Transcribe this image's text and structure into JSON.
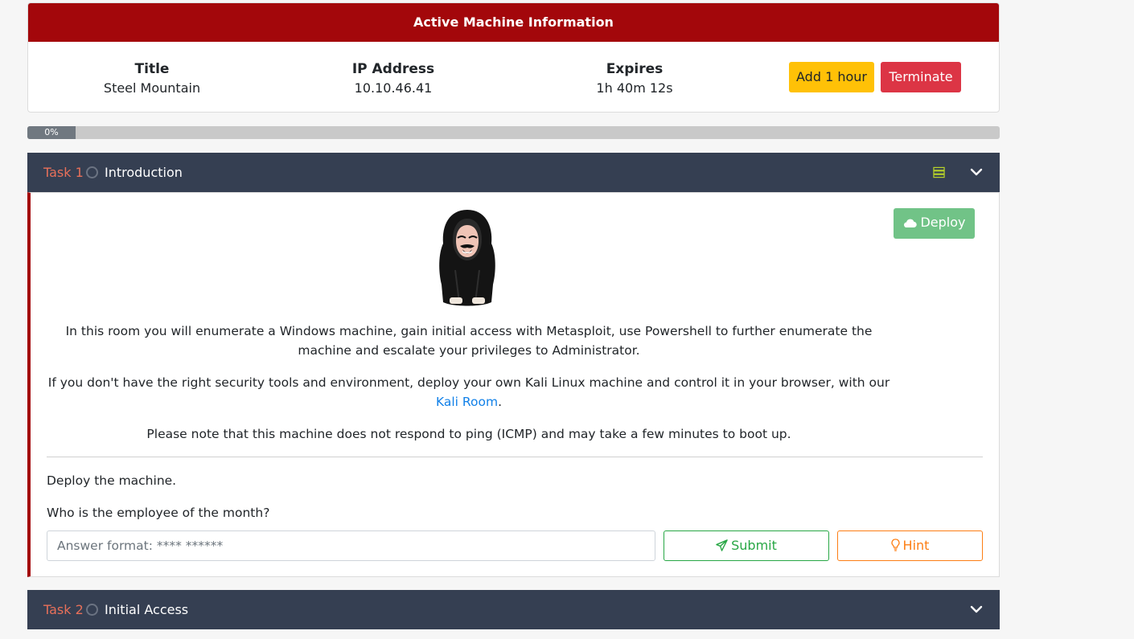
{
  "machine": {
    "header": "Active Machine Information",
    "title_label": "Title",
    "title_value": "Steel Mountain",
    "ip_label": "IP Address",
    "ip_value": "10.10.46.41",
    "expires_label": "Expires",
    "expires_value": "1h 40m 12s",
    "add_hour_label": "Add 1 hour",
    "terminate_label": "Terminate"
  },
  "progress": {
    "label": "0%",
    "value_percent": 0
  },
  "tasks": [
    {
      "number": "Task 1",
      "title": "Introduction",
      "deploy_label": "Deploy",
      "paragraphs": [
        "In this room you will enumerate a Windows machine, gain initial access with Metasploit, use Powershell to further enumerate the machine and escalate your privileges to Administrator.",
        "Please note that this machine does not respond to ping (ICMP) and may take a few minutes to boot up."
      ],
      "kali_para_prefix": "If you don't have the right security tools and environment, deploy your own Kali Linux machine and control it in your browser, with our ",
      "kali_link_text": "Kali Room",
      "kali_para_suffix": ".",
      "questions": [
        "Deploy the machine.",
        "Who is the employee of the month?"
      ],
      "answer_placeholder": "Answer format: **** ******",
      "submit_label": "Submit",
      "hint_label": "Hint"
    },
    {
      "number": "Task 2",
      "title": "Initial Access"
    }
  ],
  "colors": {
    "header_red": "#a3070b",
    "task_bar": "#353f52",
    "task_number": "#e8705a",
    "warning": "#ffc107",
    "danger": "#dc3545",
    "success": "#28a745",
    "hint": "#fd7e14",
    "link": "#1281e8"
  },
  "icons": {
    "task_status": "circle-outline-icon",
    "task_list": "server-list-icon",
    "expand": "chevron-down-icon",
    "deploy": "cloud-icon",
    "submit": "paper-plane-icon",
    "hint": "lightbulb-icon"
  }
}
